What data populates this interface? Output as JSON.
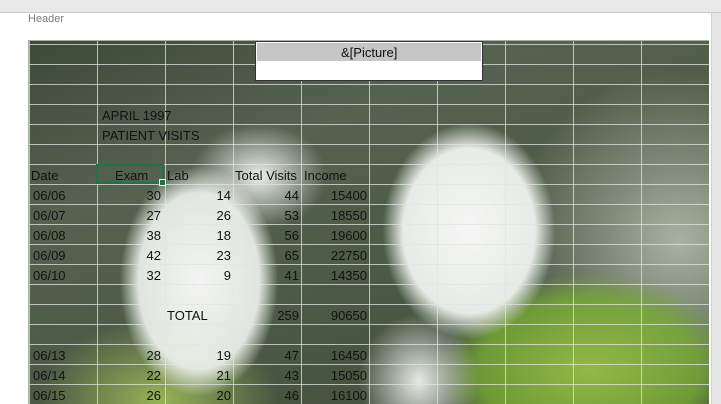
{
  "header_label": "Header",
  "header_picture_placeholder": "&[Picture]",
  "title_line1": "APRIL 1997",
  "title_line2": "PATIENT VISITS",
  "columns": [
    "Date",
    "Exam",
    "Lab",
    "Total Visits",
    "Income"
  ],
  "rows_block1": [
    {
      "date": "06/06",
      "exam": "30",
      "lab": "14",
      "total": "44",
      "income": "15400"
    },
    {
      "date": "06/07",
      "exam": "27",
      "lab": "26",
      "total": "53",
      "income": "18550"
    },
    {
      "date": "06/08",
      "exam": "38",
      "lab": "18",
      "total": "56",
      "income": "19600"
    },
    {
      "date": "06/09",
      "exam": "42",
      "lab": "23",
      "total": "65",
      "income": "22750"
    },
    {
      "date": "06/10",
      "exam": "32",
      "lab": "9",
      "total": "41",
      "income": "14350"
    }
  ],
  "total_row": {
    "label": "TOTAL",
    "total": "259",
    "income": "90650"
  },
  "rows_block2": [
    {
      "date": "06/13",
      "exam": "28",
      "lab": "19",
      "total": "47",
      "income": "16450"
    },
    {
      "date": "06/14",
      "exam": "22",
      "lab": "21",
      "total": "43",
      "income": "15050"
    },
    {
      "date": "06/15",
      "exam": "26",
      "lab": "20",
      "total": "46",
      "income": "16100"
    }
  ]
}
